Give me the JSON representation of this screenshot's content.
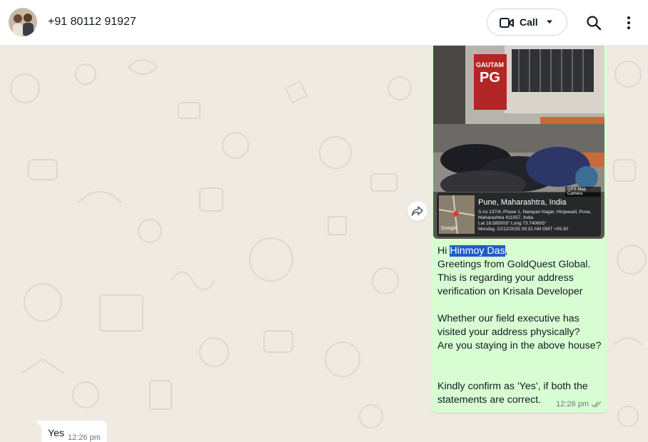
{
  "header": {
    "contact_name": "+91 80112 91927",
    "call_label": "Call"
  },
  "outgoing_message": {
    "greeting_prefix": "Hi ",
    "highlighted_name": "Hinmoy Das",
    "greeting_suffix": ",",
    "body": "Greetings from GoldQuest Global.\nThis is regarding your address verification on Krisala Developer\n\nWhether our field executive has visited your address physically?\nAre you staying in the above house?\n\n\nKindly confirm as 'Yes', if both the statements are correct.",
    "time": "12:26 pm",
    "photo": {
      "sign_line1": "GAUTAM",
      "sign_line2": "PG",
      "location_title": "Pune, Maharashtra, India",
      "address_line1": "S.no 137/4, Phase 1, Narayan Nagar, Hinjawadi, Pune,",
      "address_line2": "Maharashtra 411057, India",
      "coords": "Lat 18.585003° Long 73.740605°",
      "datetime": "Monday, 22/12/2025 09:32 AM GMT +05:30",
      "gps_badge": "GPS Map Camera",
      "map_brand": "Google"
    }
  },
  "incoming_message": {
    "text": "Yes",
    "time": "12:26 pm"
  },
  "colors": {
    "outgoing_bubble": "#d9fdd3",
    "incoming_bubble": "#ffffff",
    "wallpaper": "#efeae2",
    "highlight": "#1e5cc8"
  },
  "icons": {
    "call": "video-camera-icon",
    "dropdown": "chevron-down-icon",
    "search": "search-icon",
    "menu": "more-vertical-icon",
    "forward": "forward-icon",
    "read_receipt": "double-check-icon"
  }
}
